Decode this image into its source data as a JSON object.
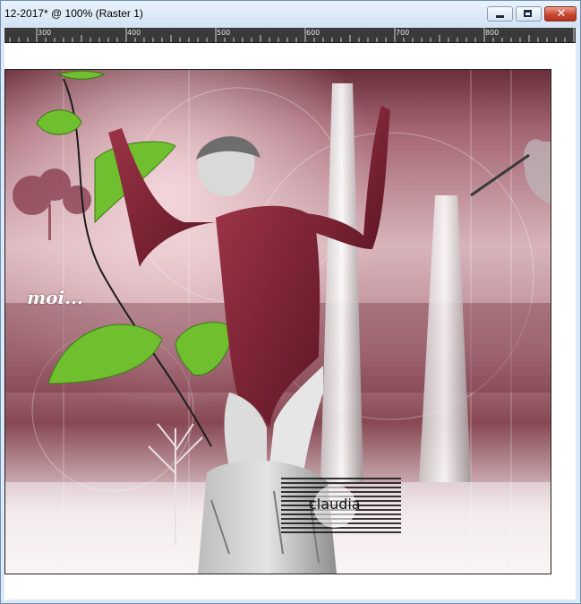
{
  "window": {
    "title": "12-2017* @ 100% (Raster 1)",
    "controls": {
      "minimize": "minimize",
      "maximize": "maximize",
      "close": "close"
    },
    "colors": {
      "titlebar": "#dce9f7",
      "close_button": "#c9452f"
    }
  },
  "ruler": {
    "labels": [
      "300",
      "400",
      "500",
      "600",
      "700",
      "800"
    ]
  },
  "artwork": {
    "overlay_text": "moi...",
    "signature_text": "claudia",
    "palette": {
      "rose": "#a46673",
      "burgundy": "#7b2236",
      "leaf_green": "#6fbf2e"
    }
  }
}
